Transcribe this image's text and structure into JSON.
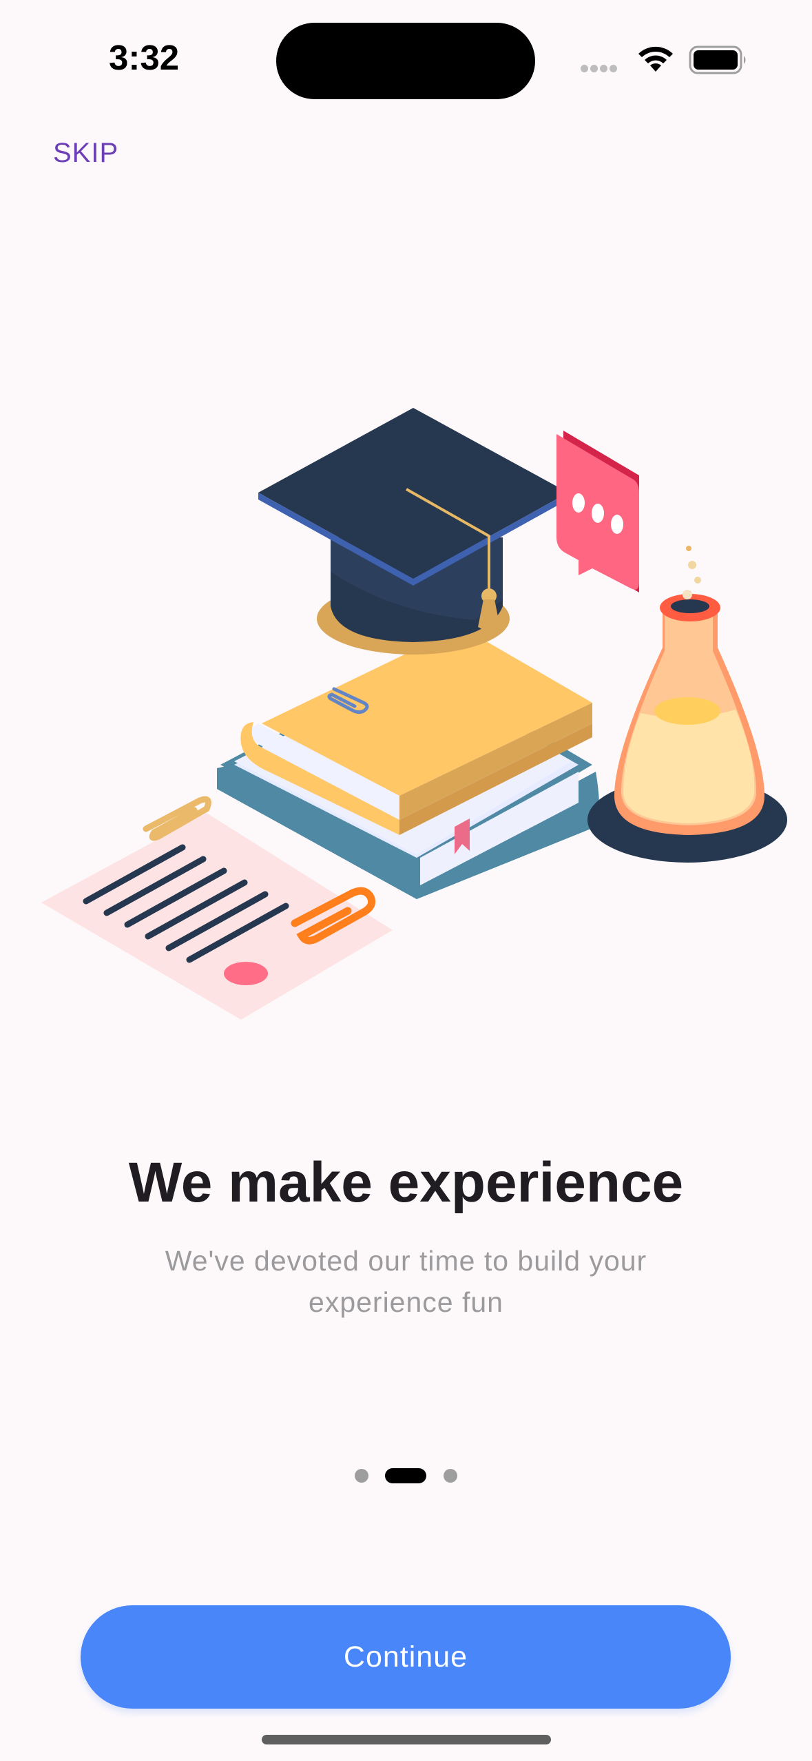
{
  "status_bar": {
    "time": "3:32",
    "icons": [
      "cellular-signal-icon",
      "wifi-icon",
      "battery-icon"
    ]
  },
  "header": {
    "skip_label": "SKIP"
  },
  "illustration": {
    "icons": [
      "graduation-cap-icon",
      "books-icon",
      "chat-bubble-icon",
      "flask-icon",
      "certificate-icon",
      "paperclip-icon"
    ]
  },
  "onboarding": {
    "title": "We make experience",
    "subtitle_line1": "We've devoted our time to build your",
    "subtitle_line2": "experience fun",
    "page_count": 3,
    "current_page": 2
  },
  "footer": {
    "continue_label": "Continue"
  },
  "colors": {
    "background": "#FDF9FB",
    "accent": "#4886F9",
    "skip": "#6D3FB6",
    "title": "#1F1D21",
    "subtitle": "#9B9A9C"
  }
}
